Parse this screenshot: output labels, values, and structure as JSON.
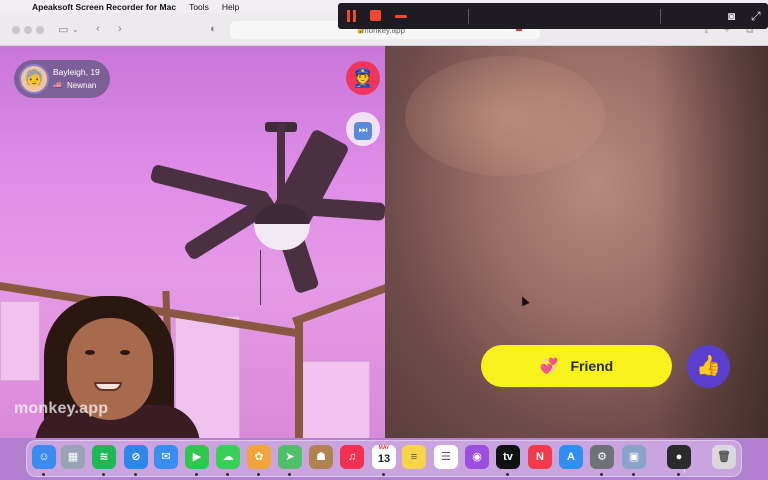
{
  "menubar": {
    "app_name": "Apeaksoft Screen Recorder for Mac",
    "items": [
      "Tools",
      "Help"
    ]
  },
  "browser": {
    "url": "monkey.app"
  },
  "user": {
    "name_age": "Bayleigh, 19",
    "flag": "🇺🇸",
    "location": "Newnan",
    "avatar_emoji": "🧓"
  },
  "watermark": "monkey.app",
  "buttons": {
    "police_emoji": "👮",
    "skip_glyph": "⏭",
    "friend_emoji": "💞",
    "friend_label": "Friend",
    "like_emoji": "👍"
  },
  "dock": {
    "calendar_month": "MAY",
    "calendar_day": "13",
    "icons": [
      {
        "name": "finder-icon",
        "color": "#3b8bf0",
        "glyph": "☺"
      },
      {
        "name": "launchpad-icon",
        "color": "#9aa3b5",
        "glyph": "▦"
      },
      {
        "name": "spotify-icon",
        "color": "#1db954",
        "glyph": "≋"
      },
      {
        "name": "safari-icon",
        "color": "#2f86e8",
        "glyph": "⊘"
      },
      {
        "name": "mail-icon",
        "color": "#3a8ef0",
        "glyph": "✉"
      },
      {
        "name": "facetime-icon",
        "color": "#2fc84d",
        "glyph": "▶"
      },
      {
        "name": "messages-icon",
        "color": "#39d05a",
        "glyph": "☁"
      },
      {
        "name": "photos-icon",
        "color": "#f0a43a",
        "glyph": "✿"
      },
      {
        "name": "maps-icon",
        "color": "#4fbf6a",
        "glyph": "➤"
      },
      {
        "name": "contacts-icon",
        "color": "#b08350",
        "glyph": "☗"
      },
      {
        "name": "music-icon",
        "color": "#f1314f",
        "glyph": "♫"
      },
      {
        "name": "calendar-icon",
        "color": "#ffffff",
        "glyph": ""
      },
      {
        "name": "notes-icon",
        "color": "#f7d44a",
        "glyph": "≡"
      },
      {
        "name": "reminders-icon",
        "color": "#ffffff",
        "glyph": "☰"
      },
      {
        "name": "podcasts-icon",
        "color": "#9b4fe0",
        "glyph": "◉"
      },
      {
        "name": "appletv-icon",
        "color": "#111111",
        "glyph": "tv"
      },
      {
        "name": "news-icon",
        "color": "#f23a4a",
        "glyph": "N"
      },
      {
        "name": "appstore-icon",
        "color": "#2e8ff0",
        "glyph": "A"
      },
      {
        "name": "system-preferences-icon",
        "color": "#6f7177",
        "glyph": "⚙"
      },
      {
        "name": "preview-icon",
        "color": "#8aa4c8",
        "glyph": "▣"
      },
      {
        "name": "screen-recorder-icon",
        "color": "#2b2b2b",
        "glyph": "●"
      },
      {
        "name": "trash-icon",
        "color": "#d9d6de",
        "glyph": "🗑"
      }
    ]
  }
}
